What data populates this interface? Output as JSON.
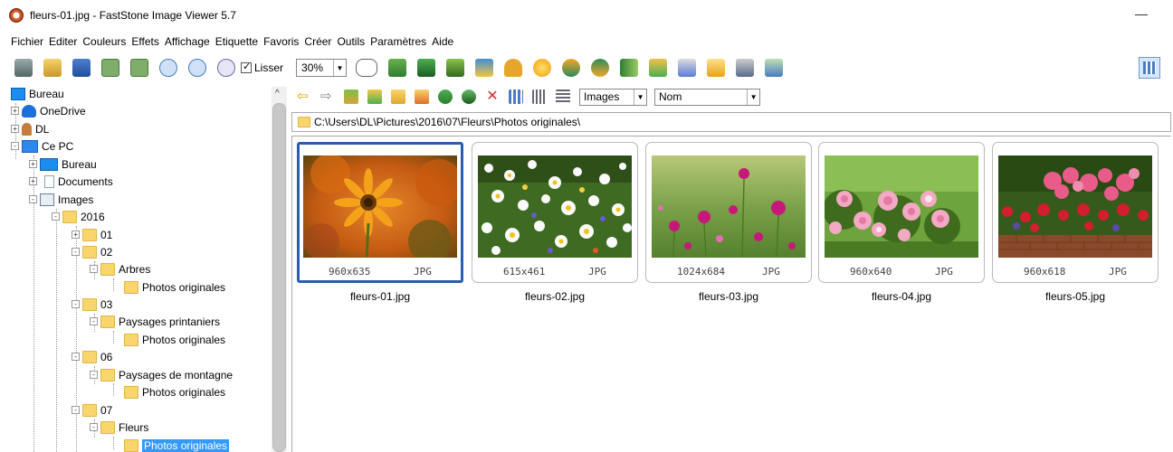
{
  "window": {
    "title": "fleurs-01.jpg  -  FastStone Image Viewer 5.7"
  },
  "menu": [
    "Fichier",
    "Editer",
    "Couleurs",
    "Effets",
    "Affichage",
    "Etiquette",
    "Favoris",
    "Créer",
    "Outils",
    "Paramètres",
    "Aide"
  ],
  "toolbar": {
    "smooth_label": "Lisser",
    "zoom_value": "30%"
  },
  "nav": {
    "filter_value": "Images",
    "sort_value": "Nom"
  },
  "path": "C:\\Users\\DL\\Pictures\\2016\\07\\Fleurs\\Photos originales\\",
  "tree": [
    {
      "label": "Bureau",
      "icon": "desktop-icon"
    },
    {
      "label": "OneDrive",
      "icon": "cloud-icon"
    },
    {
      "label": "DL",
      "icon": "user-icon"
    },
    {
      "label": "Ce PC",
      "icon": "computer-icon"
    },
    {
      "label": "Bureau",
      "icon": "desktop-icon"
    },
    {
      "label": "Documents",
      "icon": "documents-icon"
    },
    {
      "label": "Images",
      "icon": "images-icon"
    },
    {
      "label": "2016",
      "icon": "folder-icon"
    },
    {
      "label": "01",
      "icon": "folder-icon"
    },
    {
      "label": "02",
      "icon": "folder-icon"
    },
    {
      "label": "Arbres",
      "icon": "folder-icon"
    },
    {
      "label": "Photos originales",
      "icon": "folder-icon"
    },
    {
      "label": "03",
      "icon": "folder-icon"
    },
    {
      "label": "Paysages printaniers",
      "icon": "folder-icon"
    },
    {
      "label": "Photos originales",
      "icon": "folder-icon"
    },
    {
      "label": "06",
      "icon": "folder-icon"
    },
    {
      "label": "Paysages de montagne",
      "icon": "folder-icon"
    },
    {
      "label": "Photos originales",
      "icon": "folder-icon"
    },
    {
      "label": "07",
      "icon": "folder-icon"
    },
    {
      "label": "Fleurs",
      "icon": "folder-icon"
    },
    {
      "label": "Photos originales",
      "icon": "folder-icon"
    }
  ],
  "thumbnails": [
    {
      "name": "fleurs-01.jpg",
      "dims": "960x635",
      "format": "JPG"
    },
    {
      "name": "fleurs-02.jpg",
      "dims": "615x461",
      "format": "JPG"
    },
    {
      "name": "fleurs-03.jpg",
      "dims": "1024x684",
      "format": "JPG"
    },
    {
      "name": "fleurs-04.jpg",
      "dims": "960x640",
      "format": "JPG"
    },
    {
      "name": "fleurs-05.jpg",
      "dims": "960x618",
      "format": "JPG"
    }
  ],
  "colors": {
    "selection": "#3399ff",
    "thumb_selected_border": "#2a5db0"
  }
}
